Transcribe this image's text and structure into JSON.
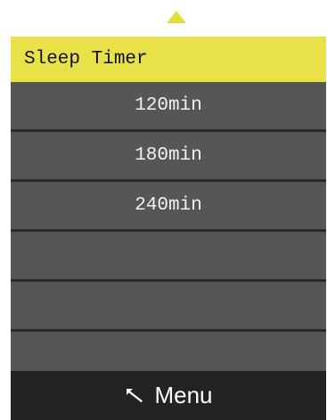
{
  "header": {
    "title": "Sleep Timer"
  },
  "options": [
    {
      "label": "120min"
    },
    {
      "label": "180min"
    },
    {
      "label": "240min"
    },
    {
      "label": ""
    },
    {
      "label": ""
    },
    {
      "label": ""
    }
  ],
  "footer": {
    "label": "Menu",
    "icon": "back-arrow-icon"
  },
  "colors": {
    "header_bg": "#e8e248",
    "accent_arrow": "#e2dc3e",
    "row_bg": "#565656",
    "divider": "#2a2a2a",
    "footer_bg": "#232323"
  }
}
